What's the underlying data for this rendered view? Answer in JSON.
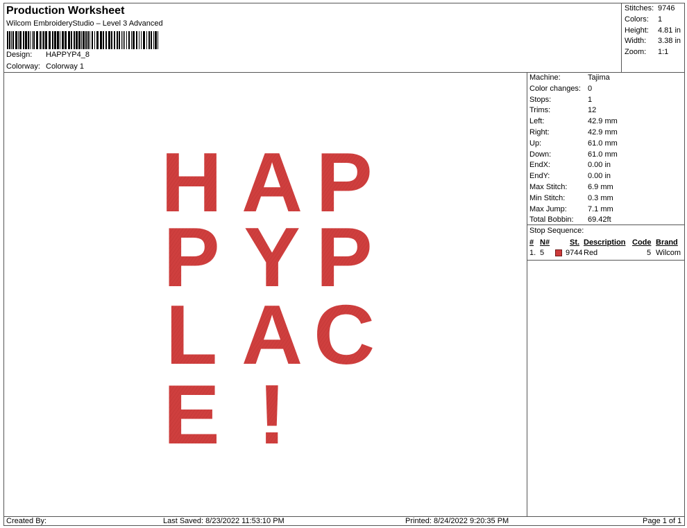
{
  "header": {
    "title": "Production Worksheet",
    "subtitle": "Wilcom EmbroideryStudio – Level 3 Advanced",
    "design_label": "Design:",
    "design_value": "HAPPYP4_8",
    "colorway_label": "Colorway:",
    "colorway_value": "Colorway 1"
  },
  "stats": [
    {
      "label": "Stitches:",
      "value": "9746"
    },
    {
      "label": "Colors:",
      "value": "1"
    },
    {
      "label": "Height:",
      "value": "4.81 in"
    },
    {
      "label": "Width:",
      "value": "3.38 in"
    },
    {
      "label": "Zoom:",
      "value": "1:1"
    }
  ],
  "machine": [
    {
      "label": "Machine:",
      "value": "Tajima"
    },
    {
      "label": "Color changes:",
      "value": "0"
    },
    {
      "label": "Stops:",
      "value": "1"
    },
    {
      "label": "Trims:",
      "value": "12"
    },
    {
      "label": "Left:",
      "value": "42.9 mm"
    },
    {
      "label": "Right:",
      "value": "42.9 mm"
    },
    {
      "label": "Up:",
      "value": "61.0 mm"
    },
    {
      "label": "Down:",
      "value": "61.0 mm"
    },
    {
      "label": "EndX:",
      "value": "0.00 in"
    },
    {
      "label": "EndY:",
      "value": "0.00 in"
    },
    {
      "label": "Max Stitch:",
      "value": "6.9 mm"
    },
    {
      "label": "Min Stitch:",
      "value": "0.3 mm"
    },
    {
      "label": "Max Jump:",
      "value": "7.1 mm"
    },
    {
      "label": "Total Bobbin:",
      "value": "69.42ft"
    }
  ],
  "stop_sequence": {
    "title": "Stop Sequence:",
    "columns": {
      "num": "#",
      "n": "N#",
      "st": "St.",
      "description": "Description",
      "code": "Code",
      "brand": "Brand"
    },
    "rows": [
      {
        "num": "1.",
        "n": "5",
        "st": "9744",
        "description": "Red",
        "code": "5",
        "brand": "Wilcom",
        "color": "#cc3a3a"
      }
    ]
  },
  "design": {
    "lines": [
      "HAP",
      "PYP",
      "LAC",
      "E!"
    ],
    "thread_color": "#cf3f3e"
  },
  "footer": {
    "created_by": "Created By:",
    "last_saved": "Last Saved: 8/23/2022 11:53:10 PM",
    "printed": "Printed: 8/24/2022 9:20:35 PM",
    "page": "Page 1 of 1"
  }
}
